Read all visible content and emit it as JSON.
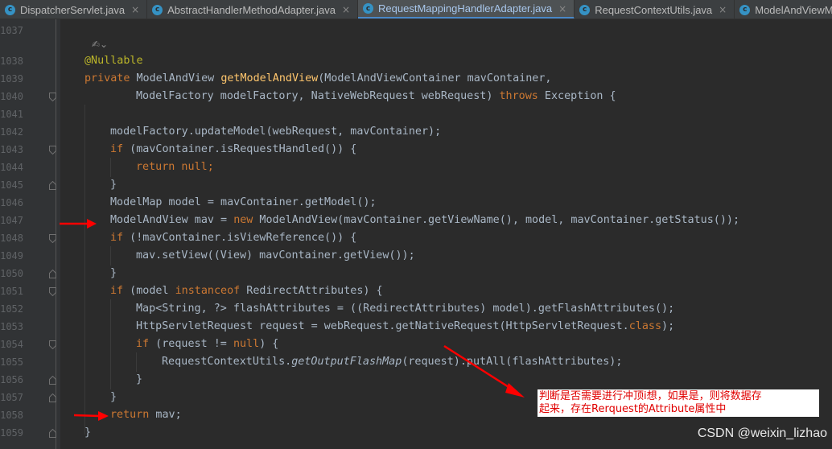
{
  "tabs": [
    {
      "label": "DispatcherServlet.java",
      "active": false,
      "icon": "class-icon"
    },
    {
      "label": "AbstractHandlerMethodAdapter.java",
      "active": false,
      "icon": "class-icon"
    },
    {
      "label": "RequestMappingHandlerAdapter.java",
      "active": true,
      "icon": "class-icon"
    },
    {
      "label": "RequestContextUtils.java",
      "active": false,
      "icon": "class-icon"
    },
    {
      "label": "ModelAndViewMet",
      "active": false,
      "icon": "class-icon"
    }
  ],
  "tab_icon_letter": "c",
  "tab_close_glyph": "×",
  "hint_glyph": "✍⌄",
  "line_numbers": [
    "1037",
    "1038",
    "1039",
    "1040",
    "1041",
    "1042",
    "1043",
    "1044",
    "1045",
    "1046",
    "1047",
    "1048",
    "1049",
    "1050",
    "1051",
    "1052",
    "1053",
    "1054",
    "1055",
    "1056",
    "1057",
    "1058",
    "1059"
  ],
  "code_lines": {
    "l1038": {
      "annotation": "@Nullable"
    },
    "l1039": {
      "kw_private": "private",
      "type": " ModelAndView ",
      "method": "getModelAndView",
      "rest": "(ModelAndViewContainer mavContainer,"
    },
    "l1040": {
      "text": "ModelFactory modelFactory, NativeWebRequest webRequest) ",
      "kw_throws": "throws",
      "rest": " Exception {"
    },
    "l1042": {
      "text": "modelFactory.updateModel(webRequest, mavContainer);"
    },
    "l1043": {
      "kw_if": "if",
      "rest": " (mavContainer.isRequestHandled()) {"
    },
    "l1044": {
      "kw_return": "return",
      "kw_null": " null",
      "rest": ";"
    },
    "l1045": {
      "text": "}"
    },
    "l1046": {
      "text": "ModelMap model = mavContainer.getModel();"
    },
    "l1047": {
      "text": "ModelAndView mav = ",
      "kw_new": "new",
      "rest": " ModelAndView(mavContainer.getViewName(), model, mavContainer.getStatus());"
    },
    "l1048": {
      "kw_if": "if",
      "rest": " (!mavContainer.isViewReference()) {"
    },
    "l1049": {
      "text": "mav.setView((View) mavContainer.getView());"
    },
    "l1050": {
      "text": "}"
    },
    "l1051": {
      "kw_if": "if",
      "mid": " (model ",
      "kw_instanceof": "instanceof",
      "rest": " RedirectAttributes) {"
    },
    "l1052": {
      "text": "Map<String, ?> flashAttributes = ((RedirectAttributes) model).getFlashAttributes();"
    },
    "l1053": {
      "text": "HttpServletRequest request = webRequest.getNativeRequest(HttpServletRequest.",
      "kw_class": "class",
      "rest": ");"
    },
    "l1054": {
      "kw_if": "if",
      "mid": " (request != ",
      "kw_null": "null",
      "rest": ") {"
    },
    "l1055": {
      "text": "RequestContextUtils.",
      "italic": "getOutputFlashMap",
      "rest": "(request).putAll(flashAttributes);"
    },
    "l1056": {
      "text": "}"
    },
    "l1057": {
      "text": "}"
    },
    "l1058": {
      "kw_return": "return",
      "rest": " mav;"
    },
    "l1059": {
      "text": "}"
    }
  },
  "annotation_note": {
    "line1": "判断是否需要进行冲顶i想，如果是，则将数据存",
    "line2": "起来，存在Rerquest的Attribute属性中"
  },
  "watermark": "CSDN @weixin_lizhao",
  "colors": {
    "keyword": "#cc7832",
    "method": "#ffc66d",
    "annotation": "#bbb529",
    "text": "#a9b7c6",
    "arrow": "#ff0000",
    "active_tab_underline": "#4a88c7"
  }
}
